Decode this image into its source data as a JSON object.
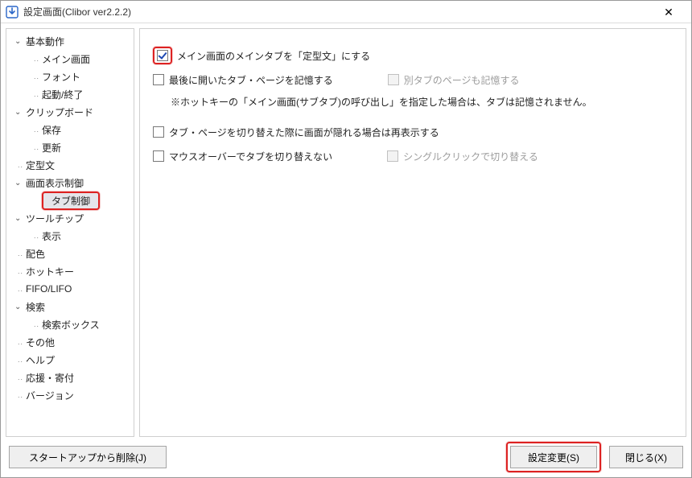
{
  "window": {
    "title": "設定画面(Clibor ver2.2.2)",
    "close_glyph": "✕"
  },
  "tree": {
    "n0": "基本動作",
    "n0a": "メイン画面",
    "n0b": "フォント",
    "n0c": "起動/終了",
    "n1": "クリップボード",
    "n1a": "保存",
    "n1b": "更新",
    "n2": "定型文",
    "n3": "画面表示制御",
    "n3a": "タブ制御",
    "n4": "ツールチップ",
    "n4a": "表示",
    "n5": "配色",
    "n6": "ホットキー",
    "n7": "FIFO/LIFO",
    "n8": "検索",
    "n8a": "検索ボックス",
    "n9": "その他",
    "n10": "ヘルプ",
    "n11": "応援・寄付",
    "n12": "バージョン"
  },
  "options": {
    "opt1": "メイン画面のメインタブを「定型文」にする",
    "opt2": "最後に開いたタブ・ページを記憶する",
    "opt2b": "別タブのページも記憶する",
    "note": "※ホットキーの「メイン画面(サブタブ)の呼び出し」を指定した場合は、タブは記憶されません。",
    "opt3": "タブ・ページを切り替えた際に画面が隠れる場合は再表示する",
    "opt4": "マウスオーバーでタブを切り替えない",
    "opt4b": "シングルクリックで切り替える"
  },
  "buttons": {
    "startup_delete": "スタートアップから削除(J)",
    "apply": "設定変更(S)",
    "close": "閉じる(X)"
  }
}
